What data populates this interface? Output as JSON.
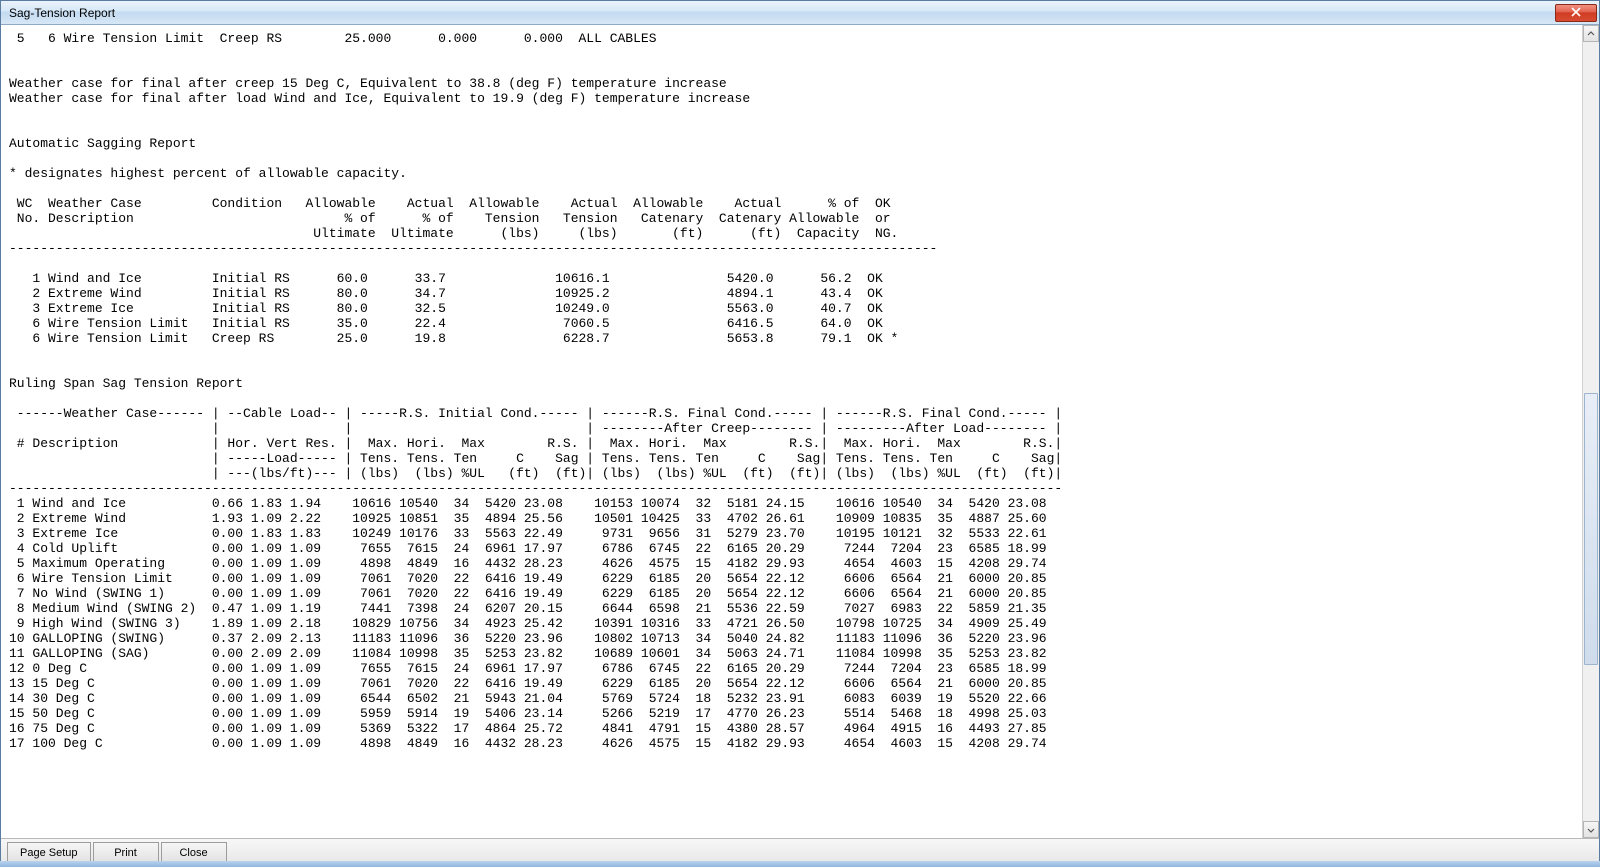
{
  "window": {
    "title": "Sag-Tension Report"
  },
  "buttons": {
    "page_setup": "Page Setup",
    "print": "Print",
    "close": "Close"
  },
  "header_line": " 5   6 Wire Tension Limit  Creep RS        25.000      0.000      0.000  ALL CABLES",
  "weather_notes": [
    "Weather case for final after creep 15 Deg C, Equivalent to 38.8 (deg F) temperature increase",
    "Weather case for final after load Wind and Ice, Equivalent to 19.9 (deg F) temperature increase"
  ],
  "section1_title": "Automatic Sagging Report",
  "section1_note": "* designates highest percent of allowable capacity.",
  "table1": {
    "head": [
      " WC  Weather Case         Condition   Allowable    Actual  Allowable    Actual  Allowable    Actual      % of  OK",
      " No. Description                           % of      % of    Tension   Tension   Catenary  Catenary Allowable  or",
      "                                       Ultimate  Ultimate      (lbs)     (lbs)       (ft)      (ft)  Capacity  NG."
    ],
    "rows": [
      {
        "no": 1,
        "desc": "Wind and Ice",
        "cond": "Initial RS",
        "allow_pct": "60.0",
        "act_pct": "33.7",
        "act_tens": "10616.1",
        "act_cat": "5420.0",
        "pct_cap": "56.2",
        "ok": "OK",
        "star": ""
      },
      {
        "no": 2,
        "desc": "Extreme Wind",
        "cond": "Initial RS",
        "allow_pct": "80.0",
        "act_pct": "34.7",
        "act_tens": "10925.2",
        "act_cat": "4894.1",
        "pct_cap": "43.4",
        "ok": "OK",
        "star": ""
      },
      {
        "no": 3,
        "desc": "Extreme Ice",
        "cond": "Initial RS",
        "allow_pct": "80.0",
        "act_pct": "32.5",
        "act_tens": "10249.0",
        "act_cat": "5563.0",
        "pct_cap": "40.7",
        "ok": "OK",
        "star": ""
      },
      {
        "no": 6,
        "desc": "Wire Tension Limit",
        "cond": "Initial RS",
        "allow_pct": "35.0",
        "act_pct": "22.4",
        "act_tens": "7060.5",
        "act_cat": "6416.5",
        "pct_cap": "64.0",
        "ok": "OK",
        "star": ""
      },
      {
        "no": 6,
        "desc": "Wire Tension Limit",
        "cond": "Creep RS",
        "allow_pct": "25.0",
        "act_pct": "19.8",
        "act_tens": "6228.7",
        "act_cat": "5653.8",
        "pct_cap": "79.1",
        "ok": "OK",
        "star": "*"
      }
    ]
  },
  "section2_title": "Ruling Span Sag Tension Report",
  "table2": {
    "head": [
      " ------Weather Case------ | --Cable Load-- | -----R.S. Initial Cond.----- | ------R.S. Final Cond.----- | ------R.S. Final Cond.----- |",
      "                          |                |                              | --------After Creep-------- | ---------After Load-------- |",
      " # Description            | Hor. Vert Res. |  Max. Hori.  Max        R.S. |  Max. Hori.  Max        R.S.|  Max. Hori.  Max        R.S.|",
      "                          | -----Load----- | Tens. Tens. Ten     C    Sag | Tens. Tens. Ten     C    Sag| Tens. Tens. Ten     C    Sag|",
      "                          | ---(lbs/ft)--- | (lbs)  (lbs) %UL   (ft)  (ft)| (lbs)  (lbs) %UL  (ft)  (ft)| (lbs)  (lbs) %UL  (ft)  (ft)|"
    ],
    "rows": [
      {
        "no": 1,
        "desc": "Wind and Ice",
        "hor": "0.66",
        "vert": "1.83",
        "res": "1.94",
        "i_mt": "10616",
        "i_ht": "10540",
        "i_ul": "34",
        "i_c": "5420",
        "i_sag": "23.08",
        "c_mt": "10153",
        "c_ht": "10074",
        "c_ul": "32",
        "c_c": "5181",
        "c_sag": "24.15",
        "l_mt": "10616",
        "l_ht": "10540",
        "l_ul": "34",
        "l_c": "5420",
        "l_sag": "23.08"
      },
      {
        "no": 2,
        "desc": "Extreme Wind",
        "hor": "1.93",
        "vert": "1.09",
        "res": "2.22",
        "i_mt": "10925",
        "i_ht": "10851",
        "i_ul": "35",
        "i_c": "4894",
        "i_sag": "25.56",
        "c_mt": "10501",
        "c_ht": "10425",
        "c_ul": "33",
        "c_c": "4702",
        "c_sag": "26.61",
        "l_mt": "10909",
        "l_ht": "10835",
        "l_ul": "35",
        "l_c": "4887",
        "l_sag": "25.60"
      },
      {
        "no": 3,
        "desc": "Extreme Ice",
        "hor": "0.00",
        "vert": "1.83",
        "res": "1.83",
        "i_mt": "10249",
        "i_ht": "10176",
        "i_ul": "33",
        "i_c": "5563",
        "i_sag": "22.49",
        "c_mt": "9731",
        "c_ht": "9656",
        "c_ul": "31",
        "c_c": "5279",
        "c_sag": "23.70",
        "l_mt": "10195",
        "l_ht": "10121",
        "l_ul": "32",
        "l_c": "5533",
        "l_sag": "22.61"
      },
      {
        "no": 4,
        "desc": "Cold Uplift",
        "hor": "0.00",
        "vert": "1.09",
        "res": "1.09",
        "i_mt": "7655",
        "i_ht": "7615",
        "i_ul": "24",
        "i_c": "6961",
        "i_sag": "17.97",
        "c_mt": "6786",
        "c_ht": "6745",
        "c_ul": "22",
        "c_c": "6165",
        "c_sag": "20.29",
        "l_mt": "7244",
        "l_ht": "7204",
        "l_ul": "23",
        "l_c": "6585",
        "l_sag": "18.99"
      },
      {
        "no": 5,
        "desc": "Maximum Operating",
        "hor": "0.00",
        "vert": "1.09",
        "res": "1.09",
        "i_mt": "4898",
        "i_ht": "4849",
        "i_ul": "16",
        "i_c": "4432",
        "i_sag": "28.23",
        "c_mt": "4626",
        "c_ht": "4575",
        "c_ul": "15",
        "c_c": "4182",
        "c_sag": "29.93",
        "l_mt": "4654",
        "l_ht": "4603",
        "l_ul": "15",
        "l_c": "4208",
        "l_sag": "29.74"
      },
      {
        "no": 6,
        "desc": "Wire Tension Limit",
        "hor": "0.00",
        "vert": "1.09",
        "res": "1.09",
        "i_mt": "7061",
        "i_ht": "7020",
        "i_ul": "22",
        "i_c": "6416",
        "i_sag": "19.49",
        "c_mt": "6229",
        "c_ht": "6185",
        "c_ul": "20",
        "c_c": "5654",
        "c_sag": "22.12",
        "l_mt": "6606",
        "l_ht": "6564",
        "l_ul": "21",
        "l_c": "6000",
        "l_sag": "20.85"
      },
      {
        "no": 7,
        "desc": "No Wind (SWING 1)",
        "hor": "0.00",
        "vert": "1.09",
        "res": "1.09",
        "i_mt": "7061",
        "i_ht": "7020",
        "i_ul": "22",
        "i_c": "6416",
        "i_sag": "19.49",
        "c_mt": "6229",
        "c_ht": "6185",
        "c_ul": "20",
        "c_c": "5654",
        "c_sag": "22.12",
        "l_mt": "6606",
        "l_ht": "6564",
        "l_ul": "21",
        "l_c": "6000",
        "l_sag": "20.85"
      },
      {
        "no": 8,
        "desc": "Medium Wind (SWING 2)",
        "hor": "0.47",
        "vert": "1.09",
        "res": "1.19",
        "i_mt": "7441",
        "i_ht": "7398",
        "i_ul": "24",
        "i_c": "6207",
        "i_sag": "20.15",
        "c_mt": "6644",
        "c_ht": "6598",
        "c_ul": "21",
        "c_c": "5536",
        "c_sag": "22.59",
        "l_mt": "7027",
        "l_ht": "6983",
        "l_ul": "22",
        "l_c": "5859",
        "l_sag": "21.35"
      },
      {
        "no": 9,
        "desc": "High Wind (SWING 3)",
        "hor": "1.89",
        "vert": "1.09",
        "res": "2.18",
        "i_mt": "10829",
        "i_ht": "10756",
        "i_ul": "34",
        "i_c": "4923",
        "i_sag": "25.42",
        "c_mt": "10391",
        "c_ht": "10316",
        "c_ul": "33",
        "c_c": "4721",
        "c_sag": "26.50",
        "l_mt": "10798",
        "l_ht": "10725",
        "l_ul": "34",
        "l_c": "4909",
        "l_sag": "25.49"
      },
      {
        "no": 10,
        "desc": "GALLOPING (SWING)",
        "hor": "0.37",
        "vert": "2.09",
        "res": "2.13",
        "i_mt": "11183",
        "i_ht": "11096",
        "i_ul": "36",
        "i_c": "5220",
        "i_sag": "23.96",
        "c_mt": "10802",
        "c_ht": "10713",
        "c_ul": "34",
        "c_c": "5040",
        "c_sag": "24.82",
        "l_mt": "11183",
        "l_ht": "11096",
        "l_ul": "36",
        "l_c": "5220",
        "l_sag": "23.96"
      },
      {
        "no": 11,
        "desc": "GALLOPING (SAG)",
        "hor": "0.00",
        "vert": "2.09",
        "res": "2.09",
        "i_mt": "11084",
        "i_ht": "10998",
        "i_ul": "35",
        "i_c": "5253",
        "i_sag": "23.82",
        "c_mt": "10689",
        "c_ht": "10601",
        "c_ul": "34",
        "c_c": "5063",
        "c_sag": "24.71",
        "l_mt": "11084",
        "l_ht": "10998",
        "l_ul": "35",
        "l_c": "5253",
        "l_sag": "23.82"
      },
      {
        "no": 12,
        "desc": "0 Deg C",
        "hor": "0.00",
        "vert": "1.09",
        "res": "1.09",
        "i_mt": "7655",
        "i_ht": "7615",
        "i_ul": "24",
        "i_c": "6961",
        "i_sag": "17.97",
        "c_mt": "6786",
        "c_ht": "6745",
        "c_ul": "22",
        "c_c": "6165",
        "c_sag": "20.29",
        "l_mt": "7244",
        "l_ht": "7204",
        "l_ul": "23",
        "l_c": "6585",
        "l_sag": "18.99"
      },
      {
        "no": 13,
        "desc": "15 Deg C",
        "hor": "0.00",
        "vert": "1.09",
        "res": "1.09",
        "i_mt": "7061",
        "i_ht": "7020",
        "i_ul": "22",
        "i_c": "6416",
        "i_sag": "19.49",
        "c_mt": "6229",
        "c_ht": "6185",
        "c_ul": "20",
        "c_c": "5654",
        "c_sag": "22.12",
        "l_mt": "6606",
        "l_ht": "6564",
        "l_ul": "21",
        "l_c": "6000",
        "l_sag": "20.85"
      },
      {
        "no": 14,
        "desc": "30 Deg C",
        "hor": "0.00",
        "vert": "1.09",
        "res": "1.09",
        "i_mt": "6544",
        "i_ht": "6502",
        "i_ul": "21",
        "i_c": "5943",
        "i_sag": "21.04",
        "c_mt": "5769",
        "c_ht": "5724",
        "c_ul": "18",
        "c_c": "5232",
        "c_sag": "23.91",
        "l_mt": "6083",
        "l_ht": "6039",
        "l_ul": "19",
        "l_c": "5520",
        "l_sag": "22.66"
      },
      {
        "no": 15,
        "desc": "50 Deg C",
        "hor": "0.00",
        "vert": "1.09",
        "res": "1.09",
        "i_mt": "5959",
        "i_ht": "5914",
        "i_ul": "19",
        "i_c": "5406",
        "i_sag": "23.14",
        "c_mt": "5266",
        "c_ht": "5219",
        "c_ul": "17",
        "c_c": "4770",
        "c_sag": "26.23",
        "l_mt": "5514",
        "l_ht": "5468",
        "l_ul": "18",
        "l_c": "4998",
        "l_sag": "25.03"
      },
      {
        "no": 16,
        "desc": "75 Deg C",
        "hor": "0.00",
        "vert": "1.09",
        "res": "1.09",
        "i_mt": "5369",
        "i_ht": "5322",
        "i_ul": "17",
        "i_c": "4864",
        "i_sag": "25.72",
        "c_mt": "4841",
        "c_ht": "4791",
        "c_ul": "15",
        "c_c": "4380",
        "c_sag": "28.57",
        "l_mt": "4964",
        "l_ht": "4915",
        "l_ul": "16",
        "l_c": "4493",
        "l_sag": "27.85"
      },
      {
        "no": 17,
        "desc": "100 Deg C",
        "hor": "0.00",
        "vert": "1.09",
        "res": "1.09",
        "i_mt": "4898",
        "i_ht": "4849",
        "i_ul": "16",
        "i_c": "4432",
        "i_sag": "28.23",
        "c_mt": "4626",
        "c_ht": "4575",
        "c_ul": "15",
        "c_c": "4182",
        "c_sag": "29.93",
        "l_mt": "4654",
        "l_ht": "4603",
        "l_ul": "15",
        "l_c": "4208",
        "l_sag": "29.74"
      }
    ]
  }
}
